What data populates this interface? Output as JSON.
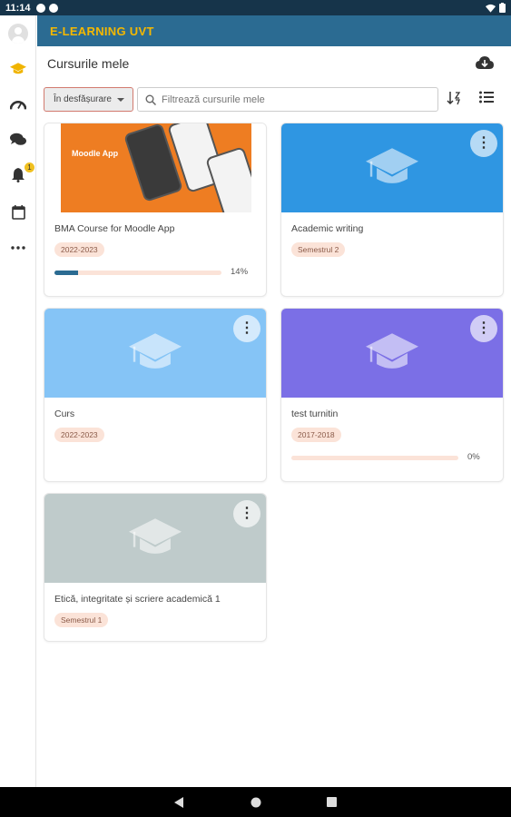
{
  "status_bar": {
    "time": "11:14"
  },
  "app": {
    "title": "E-LEARNING UVT"
  },
  "sidebar": {
    "notification_count": "1"
  },
  "page": {
    "title": "Cursurile mele"
  },
  "filter": {
    "selected": "În desfășurare",
    "search_placeholder": "Filtrează cursurile mele"
  },
  "colors": {
    "header": "#2b6b92",
    "header_text": "#f5b800",
    "accent": "#2b6b92",
    "tag_bg": "#fbe3d8",
    "banner_blue": "#2f96e2",
    "banner_light_blue": "#85c4f6",
    "banner_purple": "#7b6fe6",
    "banner_gray": "#bfcbcb"
  },
  "courses": [
    {
      "title": "BMA Course for Moodle App",
      "tag": "2022-2023",
      "progress": 14,
      "progress_label": "14%",
      "image": "moodle-app-promo",
      "app_name": "Moodle App"
    },
    {
      "title": "Academic writing",
      "tag": "Semestrul 2",
      "image": "graduation-cap-icon"
    },
    {
      "title": "Curs",
      "tag": "2022-2023",
      "image": "graduation-cap-icon"
    },
    {
      "title": "test turnitin",
      "tag": "2017-2018",
      "progress": 0,
      "progress_label": "0%",
      "image": "graduation-cap-icon"
    },
    {
      "title": "Etică, integritate și scriere academică 1",
      "tag": "Semestrul 1",
      "image": "graduation-cap-icon"
    }
  ]
}
